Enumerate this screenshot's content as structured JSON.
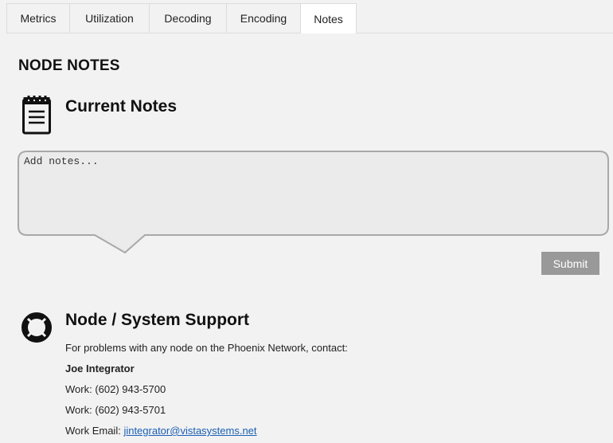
{
  "tabs": [
    {
      "label": "Metrics",
      "active": false
    },
    {
      "label": "Utilization",
      "active": false
    },
    {
      "label": "Decoding",
      "active": false
    },
    {
      "label": "Encoding",
      "active": false
    },
    {
      "label": "Notes",
      "active": true
    }
  ],
  "page_title": "NODE NOTES",
  "notes": {
    "icon": "notepad-icon",
    "heading": "Current Notes",
    "placeholder": "Add notes...",
    "value": "",
    "submit_label": "Submit"
  },
  "support": {
    "icon": "lifebuoy-icon",
    "heading": "Node / System Support",
    "intro": "For problems with any node on the Phoenix Network, contact:",
    "contact_name": "Joe Integrator",
    "work_phone_1": "Work: (602) 943-5700",
    "work_phone_2": "Work: (602) 943-5701",
    "email_label": "Work Email: ",
    "email": "jintegrator@vistasystems.net"
  },
  "colors": {
    "background": "#f2f2f2",
    "active_tab": "#ffffff",
    "submit_button": "#999999",
    "link": "#1a5fb4"
  }
}
